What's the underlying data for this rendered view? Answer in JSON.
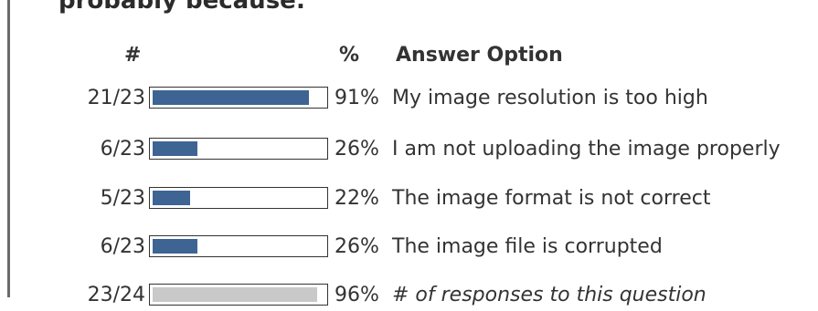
{
  "heading": "probably because:",
  "columns": {
    "count": "#",
    "percent": "%",
    "option": "Answer Option"
  },
  "rows": [
    {
      "count": "21/23",
      "percent": "91%",
      "fraction": 0.91,
      "option": "My image resolution is too high",
      "style": "answer"
    },
    {
      "count": "6/23",
      "percent": "26%",
      "fraction": 0.26,
      "option": "I am not uploading the image properly",
      "style": "answer"
    },
    {
      "count": "5/23",
      "percent": "22%",
      "fraction": 0.22,
      "option": "The image format is not correct",
      "style": "answer"
    },
    {
      "count": "6/23",
      "percent": "26%",
      "fraction": 0.26,
      "option": "The image file is corrupted",
      "style": "answer"
    },
    {
      "count": "23/24",
      "percent": "96%",
      "fraction": 0.96,
      "option": "# of responses to this question",
      "style": "total"
    }
  ],
  "colors": {
    "answer_bar": "#3e6494",
    "total_bar": "#c9c9c9"
  }
}
